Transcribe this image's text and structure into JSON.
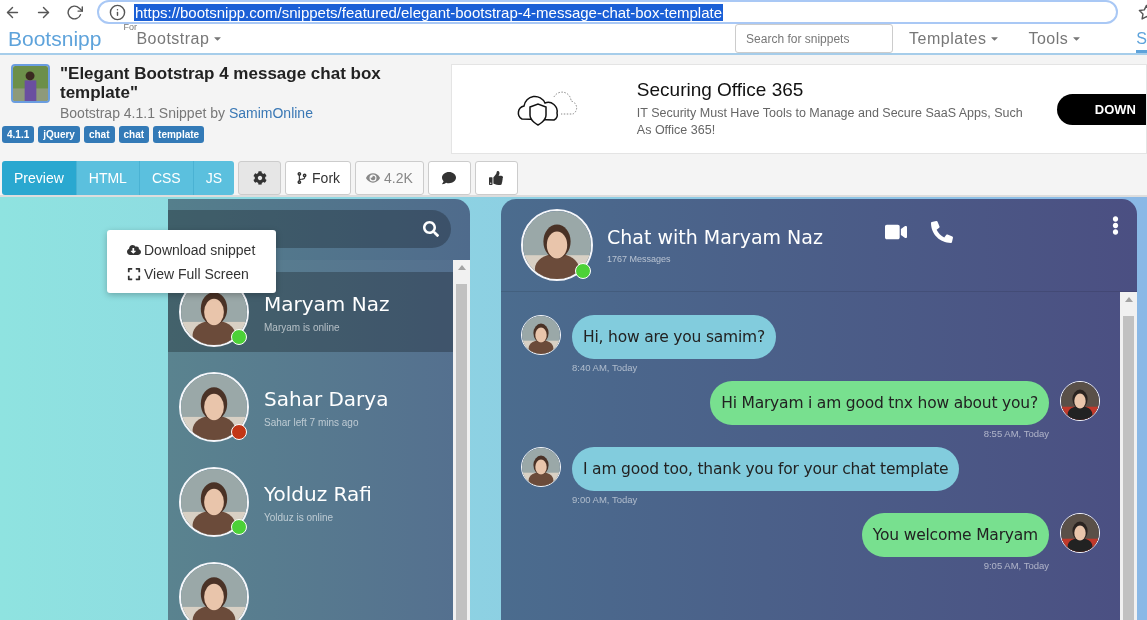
{
  "browser": {
    "url": "https://bootsnipp.com/snippets/featured/elegant-bootstrap-4-message-chat-box-template"
  },
  "nav": {
    "brand": "Bootsnipp",
    "for_label": "For",
    "framework": "Bootstrap",
    "search_placeholder": "Search for snippets",
    "items": [
      "Templates",
      "Tools"
    ],
    "cut_item": "S"
  },
  "snippet": {
    "title": "\"Elegant Bootstrap 4 message chat box template\"",
    "byline": "Bootstrap 4.1.1 Snippet by",
    "author": "SamimOnline",
    "tags": [
      "4.1.1",
      "jQuery",
      "chat",
      "chat",
      "template"
    ]
  },
  "ad": {
    "title": "Securing Office 365",
    "text": "IT Security Must Have Tools to Manage and Secure SaaS Apps, Such As Office 365!",
    "button": "DOWN"
  },
  "toolbar": {
    "tabs": [
      {
        "label": "Preview",
        "selected": true
      },
      {
        "label": "HTML",
        "selected": false
      },
      {
        "label": "CSS",
        "selected": false
      },
      {
        "label": "JS",
        "selected": false
      }
    ],
    "fork": "Fork",
    "views": "4.2K"
  },
  "menu": {
    "items": [
      {
        "kind": "download",
        "label": "Download snippet"
      },
      {
        "kind": "fullscreen",
        "label": "View Full Screen"
      }
    ]
  },
  "contacts": [
    {
      "name": "Maryam Naz",
      "status": "Maryam is online",
      "color": "#4cd137",
      "selected": true
    },
    {
      "name": "Sahar Darya",
      "status": "Sahar left 7 mins ago",
      "color": "#c23616",
      "selected": false
    },
    {
      "name": "Yolduz Rafi",
      "status": "Yolduz is online",
      "color": "#4cd137",
      "selected": false
    }
  ],
  "chat": {
    "title": "Chat with Maryam Naz",
    "count": "1767 Messages",
    "color": "#4cd137",
    "messages": [
      {
        "kind": "incoming",
        "text": "Hi, how are you samim?",
        "time": "8:40 AM, Today"
      },
      {
        "kind": "outgoing",
        "text": "Hi Maryam i am good tnx how about you?",
        "time": "8:55 AM, Today"
      },
      {
        "kind": "incoming",
        "text": "I am good too, thank you for your chat template",
        "time": "9:00 AM, Today"
      },
      {
        "kind": "outgoing",
        "text": "You welcome Maryam",
        "time": "9:05 AM, Today"
      }
    ]
  }
}
